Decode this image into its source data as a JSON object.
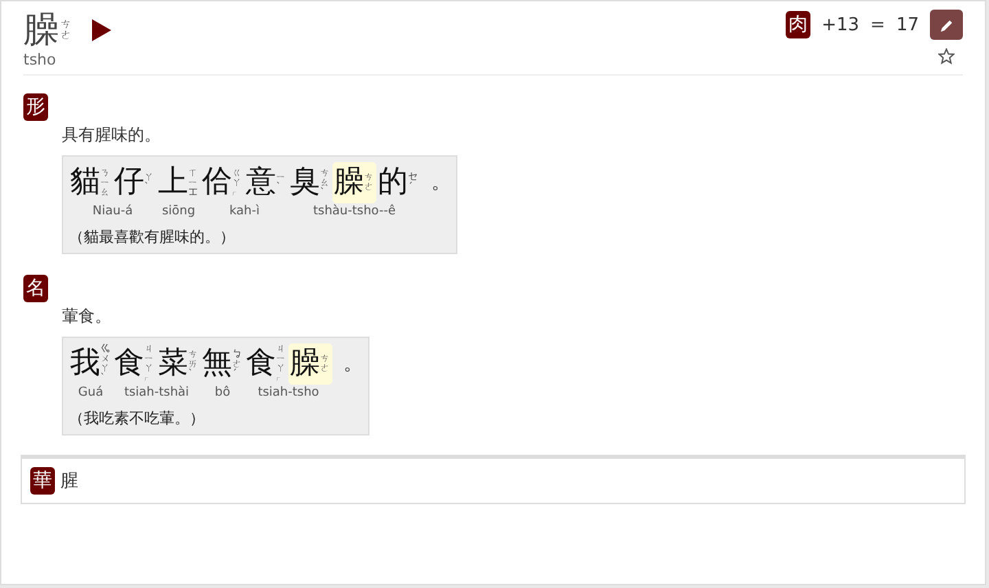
{
  "entry": {
    "title": "臊",
    "zhuyin": "ㄘㄜ",
    "romanization": "tsho",
    "radical": "肉",
    "stroke_extra": "+13",
    "equals": "=",
    "stroke_total": "17"
  },
  "definitions": [
    {
      "pos": "形",
      "text": "具有腥味的。",
      "example": {
        "segments": [
          {
            "chars": [
              {
                "ch": "貓",
                "zhuyin": "ㄋㄧㄠ",
                "highlighted": false
              },
              {
                "ch": "仔",
                "zhuyin": "ㄚˋ",
                "highlighted": false
              }
            ],
            "roman": "Niau-á"
          },
          {
            "chars": [
              {
                "ch": "上",
                "zhuyin": "ㄒㄧㆲ",
                "highlighted": false
              }
            ],
            "roman": "siōng"
          },
          {
            "chars": [
              {
                "ch": "佮",
                "zhuyin": "ㄍㄚㆷ",
                "highlighted": false
              },
              {
                "ch": "意",
                "zhuyin": "ㄧˋ",
                "highlighted": false
              }
            ],
            "roman": "kah-ì"
          },
          {
            "chars": [
              {
                "ch": "臭",
                "zhuyin": "ㄘㄠˋ",
                "highlighted": false
              },
              {
                "ch": "臊",
                "zhuyin": "ㄘㄜ",
                "highlighted": true
              },
              {
                "ch": "的",
                "zhuyin": "ㆤˊ",
                "highlighted": false
              }
            ],
            "roman": "tshàu-tsho--ê"
          }
        ],
        "punct": "。",
        "translation": "（貓最喜歡有腥味的。）"
      }
    },
    {
      "pos": "名",
      "text": "葷食。",
      "example": {
        "segments": [
          {
            "chars": [
              {
                "ch": "我",
                "zhuyin": "ㆣㄨㄚˋ",
                "highlighted": false
              }
            ],
            "roman": "Guá"
          },
          {
            "chars": [
              {
                "ch": "食",
                "zhuyin": "ㄐㄧㄚㆷ",
                "highlighted": false
              },
              {
                "ch": "菜",
                "zhuyin": "ㄘㄞˋ",
                "highlighted": false
              }
            ],
            "roman": "tsiah-tshài"
          },
          {
            "chars": [
              {
                "ch": "無",
                "zhuyin": "ㆠㄜˊ",
                "highlighted": false
              }
            ],
            "roman": "bô"
          },
          {
            "chars": [
              {
                "ch": "食",
                "zhuyin": "ㄐㄧㄚㆷ",
                "highlighted": false
              },
              {
                "ch": "臊",
                "zhuyin": "ㄘㄜ",
                "highlighted": true
              }
            ],
            "roman": "tsiah-tsho"
          }
        ],
        "punct": "。",
        "translation": "（我吃素不吃葷。）"
      }
    }
  ],
  "mandarin": {
    "label": "華",
    "text": "腥"
  }
}
